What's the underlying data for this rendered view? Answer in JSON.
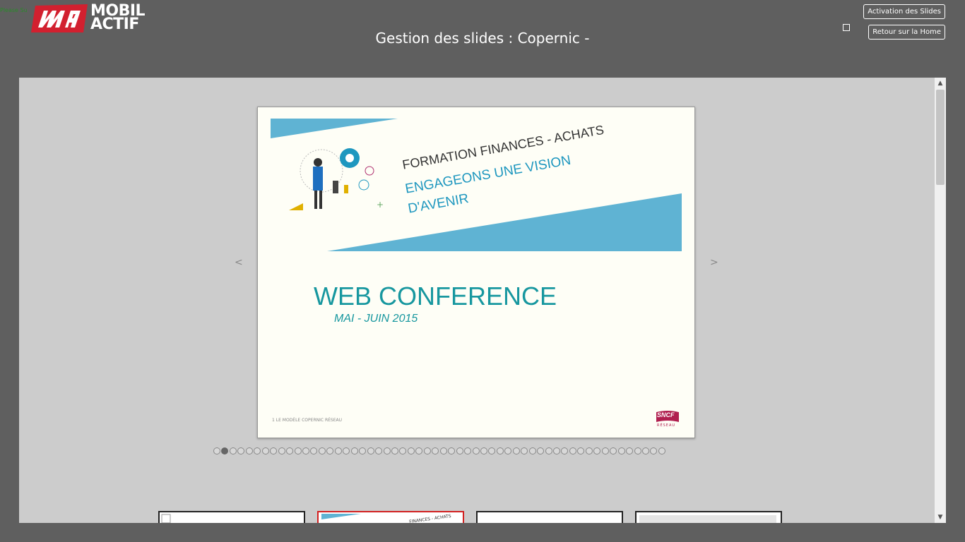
{
  "status_text": "Please Su",
  "logo": {
    "line1": "MOBIL",
    "line2": "ACTIF"
  },
  "page_title": "Gestion des slides : Copernic -",
  "buttons": {
    "activation": "Activation des Slides",
    "retour": "Retour sur la Home"
  },
  "colors": {
    "background": "#5f5f5f",
    "panel": "#cccccc",
    "accent_blue": "#1e97bf",
    "teal": "#17979f",
    "selected_border": "#d22020"
  },
  "slide": {
    "title1": "FORMATION FINANCES - ACHATS",
    "title2": "ENGAGEONS UNE VISION",
    "title3": "D'AVENIR",
    "heading": "WEB CONFERENCE",
    "subheading": "MAI - JUIN 2015",
    "footer": "1  LE MODÈLE  COPERNIC  RÉSEAU",
    "brand": "SNCF",
    "brand_sub": "RÉSEAU"
  },
  "nav": {
    "prev": "<",
    "next": ">"
  },
  "pagination": {
    "total": 56,
    "active_index": 1
  },
  "thumbnails": [
    {
      "label": ""
    },
    {
      "label": "FINANCES - ACHATS"
    },
    {
      "label": ""
    },
    {
      "label": ""
    }
  ]
}
